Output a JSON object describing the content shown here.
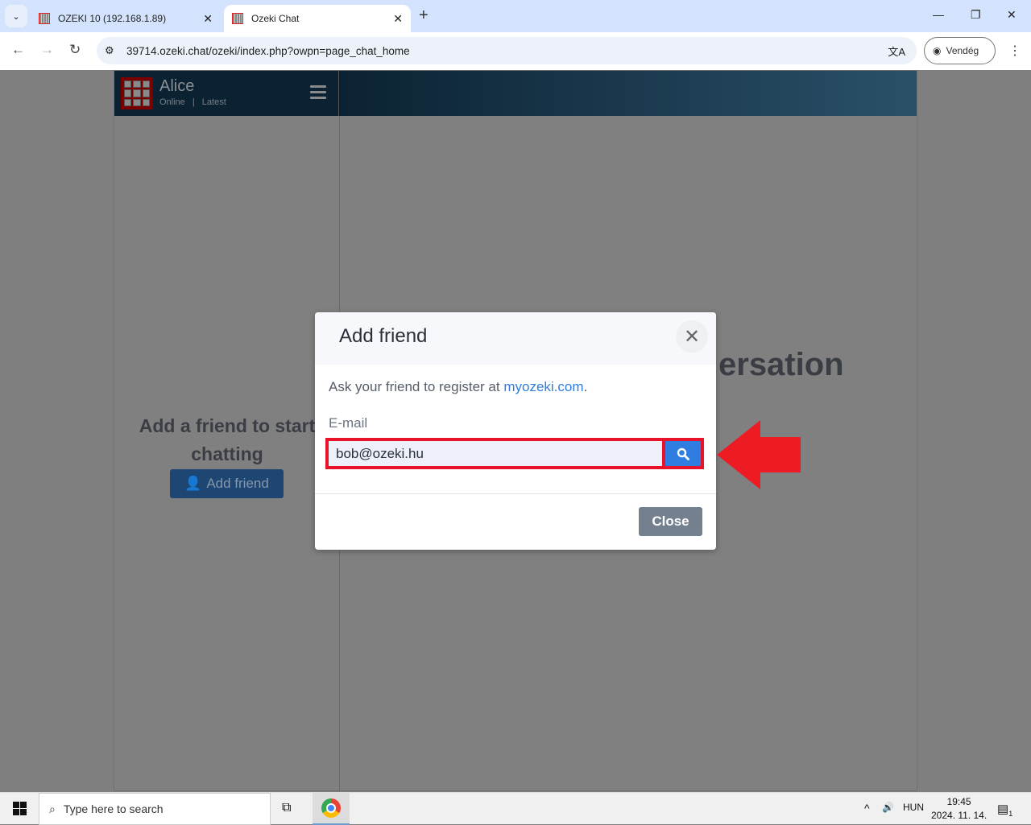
{
  "browser": {
    "tabs": [
      {
        "title": "OZEKI 10 (192.168.1.89)",
        "active": false
      },
      {
        "title": "Ozeki Chat",
        "active": true
      }
    ],
    "url": "39714.ozeki.chat/ozeki/index.php?owpn=page_chat_home",
    "profile_label": "Vendég"
  },
  "app": {
    "user_name": "Alice",
    "status": "Online",
    "separator": "|",
    "filter": "Latest",
    "empty_left_line1": "Add a friend to start",
    "empty_left_line2": "chatting",
    "add_friend_button": "Add friend",
    "conversation_hint_visible": "ersation"
  },
  "modal": {
    "title": "Add friend",
    "text_prefix": "Ask your friend to register at ",
    "link": "myozeki.com",
    "text_suffix": ".",
    "email_label": "E-mail",
    "email_value": "bob@ozeki.hu",
    "close_button": "Close"
  },
  "annotation": {
    "arrow_color": "#ed1c24"
  },
  "taskbar": {
    "search_placeholder": "Type here to search",
    "language": "HUN",
    "time": "19:45",
    "date": "2024. 11. 14.",
    "notification_count": "1"
  }
}
